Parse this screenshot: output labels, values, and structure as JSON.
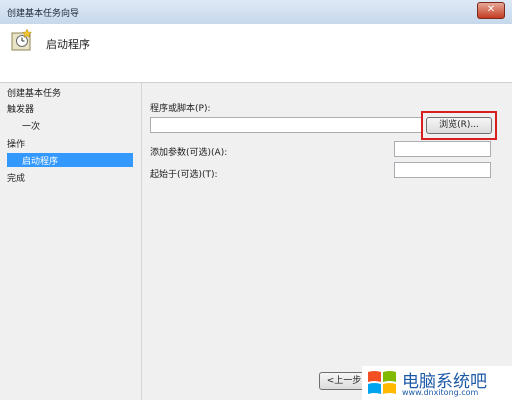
{
  "window": {
    "title": "创建基本任务向导",
    "close_glyph": "✕"
  },
  "header": {
    "title": "启动程序",
    "icon": "task-clock-icon"
  },
  "sidebar": {
    "items": [
      {
        "label": "创建基本任务",
        "active": false
      },
      {
        "label": "触发器",
        "active": false
      },
      {
        "label": "一次",
        "active": false
      },
      {
        "label": "操作",
        "active": false
      },
      {
        "label": "启动程序",
        "active": true
      },
      {
        "label": "完成",
        "active": false
      }
    ]
  },
  "form": {
    "program_label": "程序或脚本(P):",
    "program_value": "",
    "browse_label": "浏览(R)...",
    "args_label": "添加参数(可选)(A):",
    "args_value": "",
    "startin_label": "起始于(可选)(T):",
    "startin_value": ""
  },
  "footer": {
    "back_label": "<上一步"
  },
  "watermark": {
    "brand": "电脑系统吧",
    "url": "www.dnxitong.com"
  },
  "colors": {
    "highlight": "#d61f1f",
    "active_nav": "#3399ff"
  }
}
